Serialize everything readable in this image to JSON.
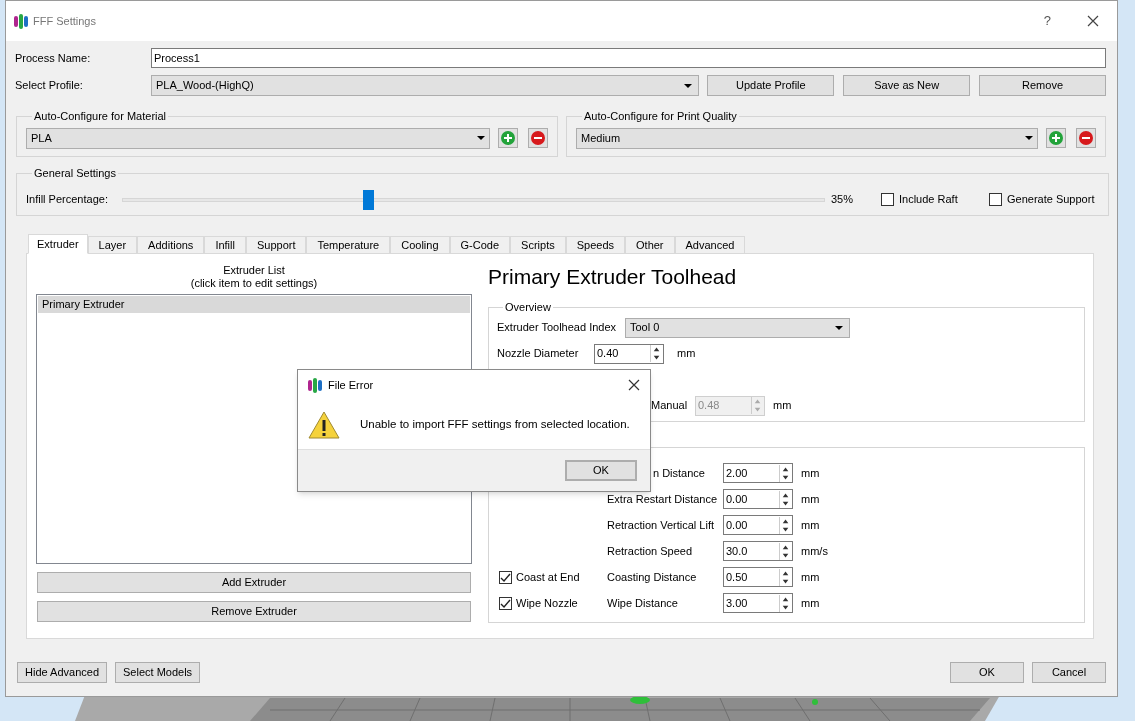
{
  "window": {
    "title": "FFF Settings",
    "help": "?"
  },
  "process_name": {
    "label": "Process Name:",
    "value": "Process1"
  },
  "select_profile": {
    "label": "Select Profile:",
    "value": "PLA_Wood-(HighQ)",
    "buttons": [
      "Update Profile",
      "Save as New",
      "Remove"
    ]
  },
  "auto_configure": [
    {
      "title": "Auto-Configure for Material",
      "value": "PLA"
    },
    {
      "title": "Auto-Configure for Print Quality",
      "value": "Medium"
    }
  ],
  "general_settings": {
    "title": "General Settings",
    "infill_label": "Infill Percentage:",
    "level": 0.35,
    "reading": "35%",
    "options": [
      {
        "label": "Include Raft",
        "checked": false
      },
      {
        "label": "Generate Support",
        "checked": false
      }
    ]
  },
  "tabs": [
    {
      "label": "Extruder",
      "selected": true
    },
    {
      "label": "Layer",
      "selected": false
    },
    {
      "label": "Additions",
      "selected": false
    },
    {
      "label": "Infill",
      "selected": false
    },
    {
      "label": "Support",
      "selected": false
    },
    {
      "label": "Temperature",
      "selected": false
    },
    {
      "label": "Cooling",
      "selected": false
    },
    {
      "label": "G-Code",
      "selected": false
    },
    {
      "label": "Scripts",
      "selected": false
    },
    {
      "label": "Speeds",
      "selected": false
    },
    {
      "label": "Other",
      "selected": false
    },
    {
      "label": "Advanced",
      "selected": false
    }
  ],
  "extruder_list": {
    "title": "Extruder List",
    "hint": "(click item to edit settings)",
    "items": [
      {
        "label": "Primary Extruder",
        "selected": true
      }
    ],
    "buttons": [
      "Add Extruder",
      "Remove Extruder"
    ]
  },
  "toolhead": {
    "heading": "Primary Extruder Toolhead",
    "overview": {
      "title": "Overview",
      "index_label": "Extruder Toolhead Index",
      "index_value": "Tool 0",
      "rows": [
        {
          "label": "Nozzle Diameter",
          "value": "0.40",
          "unit": "mm",
          "disabled": false
        },
        {
          "label": "Manual",
          "value": "0.48",
          "unit": "mm",
          "disabled": true
        }
      ]
    },
    "retraction_rows": [
      {
        "label": "n Distance",
        "value": "2.00",
        "unit": "mm"
      },
      {
        "label": "Extra Restart Distance",
        "value": "0.00",
        "unit": "mm"
      },
      {
        "label": "Retraction Vertical Lift",
        "value": "0.00",
        "unit": "mm"
      },
      {
        "label": "Retraction Speed",
        "value": "30.0",
        "unit": "mm/s"
      },
      {
        "label": "Coasting Distance",
        "value": "0.50",
        "unit": "mm",
        "check": {
          "label": "Coast at End",
          "checked": true
        }
      },
      {
        "label": "Wipe Distance",
        "value": "3.00",
        "unit": "mm",
        "check": {
          "label": "Wipe Nozzle",
          "checked": true
        }
      }
    ]
  },
  "footer": {
    "left": [
      "Hide Advanced",
      "Select Models"
    ],
    "right": [
      "OK",
      "Cancel"
    ]
  },
  "dialog": {
    "title": "File Error",
    "message": "Unable to import FFF settings from selected location.",
    "button": "OK"
  }
}
